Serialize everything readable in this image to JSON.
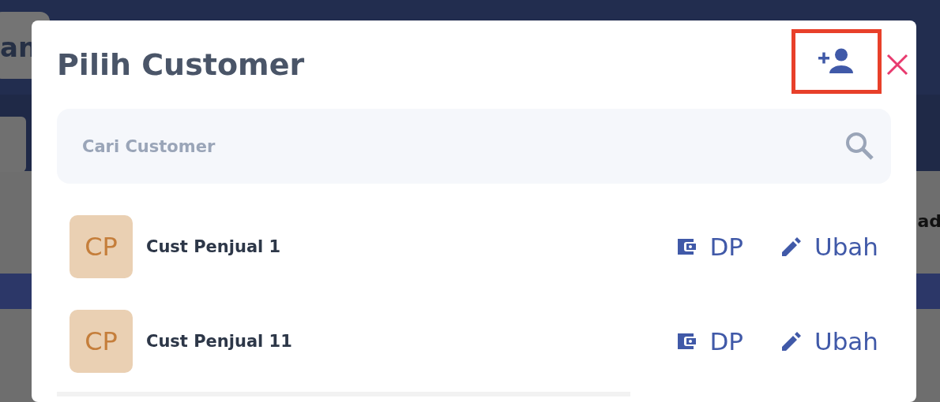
{
  "background": {
    "texts": [
      {
        "kind": "left",
        "text": "an"
      },
      {
        "kind": "right",
        "text": "ad"
      }
    ]
  },
  "dialog": {
    "title": "Pilih Customer",
    "add_button": {
      "highlighted": true
    },
    "search": {
      "placeholder": "Cari Customer"
    },
    "customers": [
      {
        "initials": "CP",
        "name": "Cust Penjual 1",
        "actions": [
          {
            "kind": "wallet",
            "label": "DP"
          },
          {
            "kind": "edit",
            "label": "Ubah"
          }
        ]
      },
      {
        "initials": "CP",
        "name": "Cust Penjual 11",
        "actions": [
          {
            "kind": "wallet",
            "label": "DP"
          },
          {
            "kind": "edit",
            "label": "Ubah"
          }
        ]
      }
    ]
  }
}
